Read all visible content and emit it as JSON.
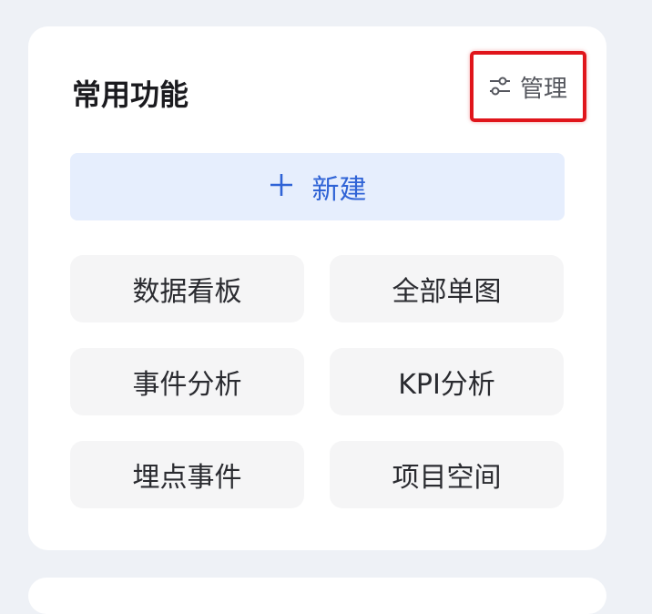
{
  "card": {
    "title": "常用功能",
    "manage_label": "管理",
    "manage_icon": "sliders-icon",
    "new_label": "新建",
    "new_icon": "plus-icon",
    "items": [
      {
        "label": "数据看板"
      },
      {
        "label": "全部单图"
      },
      {
        "label": "事件分析"
      },
      {
        "label": "KPI分析"
      },
      {
        "label": "埋点事件"
      },
      {
        "label": "项目空间"
      }
    ]
  },
  "colors": {
    "accent": "#2f63d6",
    "new_button_bg": "#e6eefd",
    "highlight_border": "#e0151b",
    "tile_bg": "#f5f5f6",
    "page_bg": "#eef1f6"
  }
}
